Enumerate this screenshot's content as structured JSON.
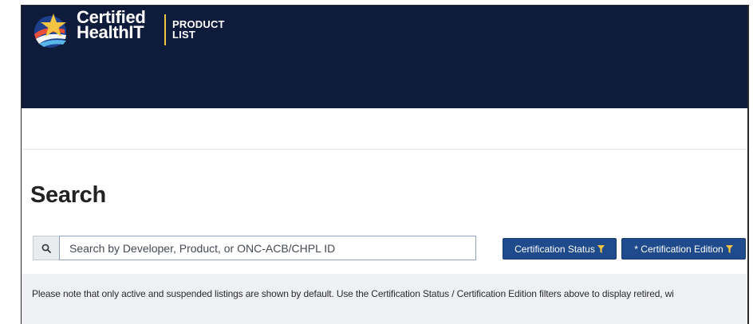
{
  "header": {
    "brand_line1": "Certified",
    "brand_line2": "HealthIT",
    "product_line1": "PRODUCT",
    "product_line2": "LIST",
    "background_color": "#0f1b3a",
    "accent_color": "#f3c343"
  },
  "page": {
    "title": "Search"
  },
  "search": {
    "icon": "search-icon",
    "placeholder": "Search by Developer, Product, or ONC-ACB/CHPL ID",
    "value": ""
  },
  "filters": {
    "certification_status_label": "Certification Status",
    "certification_edition_label": "* Certification Edition",
    "icon": "filter-icon",
    "button_color": "#1f4a8c"
  },
  "notice": {
    "text": "Please note that only active and suspended listings are shown by default. Use the Certification Status / Certification Edition filters above to display retired, wi"
  }
}
